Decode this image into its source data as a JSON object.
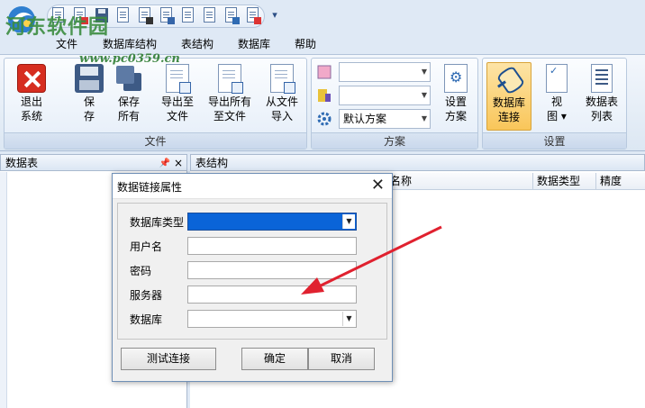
{
  "watermark": {
    "title": "河东软件园",
    "url": "www.pc0359.cn"
  },
  "menu": [
    "文件",
    "数据库结构",
    "表结构",
    "数据库",
    "帮助"
  ],
  "ribbon": {
    "file_group": {
      "label": "文件",
      "buttons": [
        {
          "label": "退出\n系统",
          "icon": "exit-icon"
        },
        {
          "label": "保\n存",
          "icon": "floppy-icon"
        },
        {
          "label": "保存\n所有",
          "icon": "floppies-icon"
        },
        {
          "label": "导出至\n文件",
          "icon": "export-doc-icon"
        },
        {
          "label": "导出所有\n至文件",
          "icon": "export-all-doc-icon"
        },
        {
          "label": "从文件\n导入",
          "icon": "import-doc-icon"
        }
      ]
    },
    "scheme_group": {
      "label": "方案",
      "combos": [
        "",
        "",
        "默认方案"
      ],
      "setup_button": "设置\n方案"
    },
    "settings_group": {
      "label": "设置",
      "buttons": [
        {
          "label": "数据库\n连接",
          "icon": "db-connect-icon",
          "active": true
        },
        {
          "label": "视\n图 ▾",
          "icon": "view-icon"
        },
        {
          "label": "数据表\n列表",
          "icon": "table-list-icon"
        }
      ]
    }
  },
  "left_panel": {
    "title": "数据表",
    "pin": "ᵖ",
    "close": "×"
  },
  "right_panel": {
    "title": "表结构",
    "columns": [
      "名称",
      "数据类型",
      "精度"
    ]
  },
  "dialog": {
    "title": "数据链接属性",
    "close": "✕",
    "fields": [
      {
        "label": "数据库类型",
        "value": "",
        "type": "dropdown"
      },
      {
        "label": "用户名",
        "value": "",
        "type": "text"
      },
      {
        "label": "密码",
        "value": "",
        "type": "text"
      },
      {
        "label": "服务器",
        "value": "",
        "type": "text"
      },
      {
        "label": "数据库",
        "value": "",
        "type": "dropdown"
      }
    ],
    "test_button": "测试连接",
    "ok_button": "确定",
    "cancel_button": "取消"
  },
  "colors": {
    "accent": "#0a64d8",
    "arrow": "#e0212f",
    "ribbon_active": "#f9c65a"
  }
}
